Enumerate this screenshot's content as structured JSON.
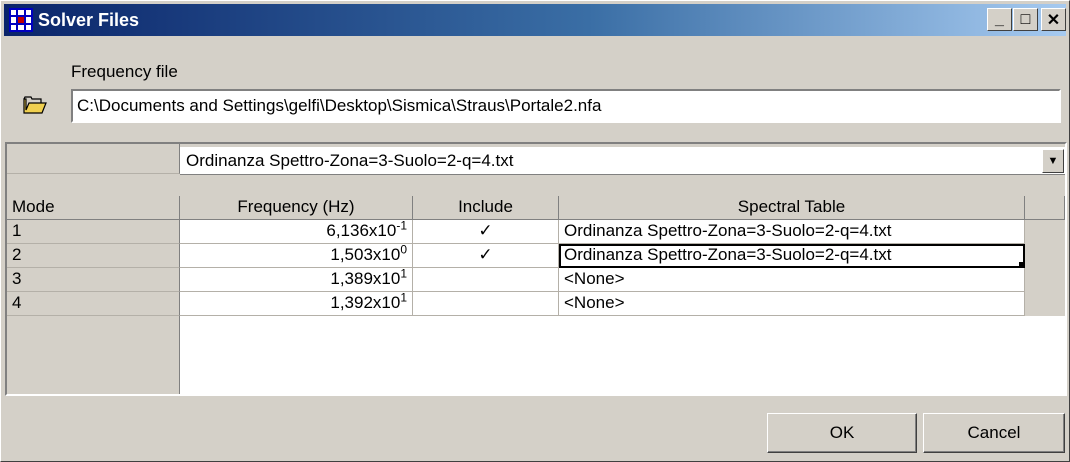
{
  "window": {
    "title": "Solver Files",
    "minimize": "_",
    "maximize": "□",
    "close": "✕"
  },
  "frequency_file": {
    "label": "Frequency file",
    "path": "C:\\Documents and Settings\\gelfi\\Desktop\\Sismica\\Straus\\Portale2.nfa"
  },
  "grid": {
    "combo_value": "Ordinanza Spettro-Zona=3-Suolo=2-q=4.txt",
    "columns": [
      "Mode",
      "Frequency (Hz)",
      "Include",
      "Spectral Table"
    ],
    "rows": [
      {
        "mode": "1",
        "freq_mantissa": "6,136x10",
        "freq_exp": "-1",
        "include": "✓",
        "table": "Ordinanza Spettro-Zona=3-Suolo=2-q=4.txt"
      },
      {
        "mode": "2",
        "freq_mantissa": "1,503x10",
        "freq_exp": "0",
        "include": "✓",
        "table": "Ordinanza Spettro-Zona=3-Suolo=2-q=4.txt"
      },
      {
        "mode": "3",
        "freq_mantissa": "1,389x10",
        "freq_exp": "1",
        "include": "",
        "table": "<None>"
      },
      {
        "mode": "4",
        "freq_mantissa": "1,392x10",
        "freq_exp": "1",
        "include": "",
        "table": "<None>"
      }
    ]
  },
  "buttons": {
    "ok": "OK",
    "cancel": "Cancel"
  },
  "colors": {
    "titlebar_start": "#0a246a",
    "titlebar_end": "#a6caf0",
    "face": "#d4d0c8"
  }
}
